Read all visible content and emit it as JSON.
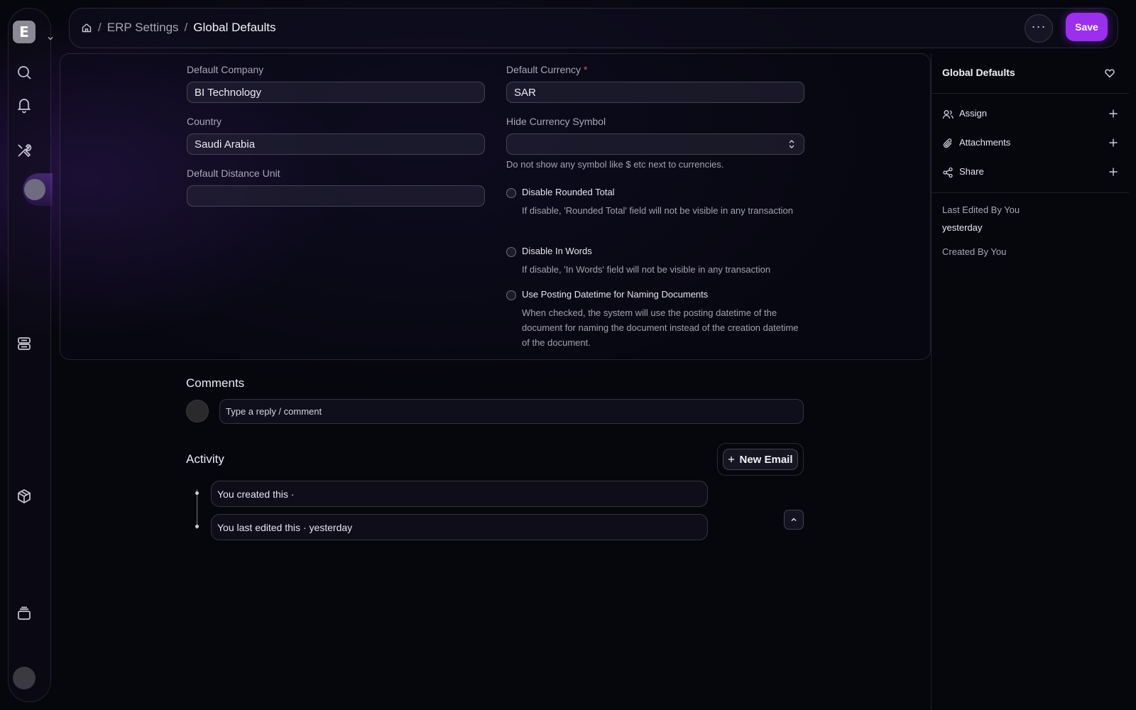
{
  "app": {
    "logo_letter": "E"
  },
  "breadcrumb": {
    "items": [
      "ERP Settings"
    ],
    "current": "Global Defaults",
    "separator": "/"
  },
  "header": {
    "more_label": "···",
    "save_label": "Save"
  },
  "form": {
    "default_company": {
      "label": "Default Company",
      "value": "BI Technology"
    },
    "country": {
      "label": "Country",
      "value": "Saudi Arabia"
    },
    "default_distance_unit": {
      "label": "Default Distance Unit",
      "value": ""
    },
    "default_currency": {
      "label": "Default Currency",
      "required_mark": "*",
      "value": "SAR"
    },
    "hide_currency_symbol": {
      "label": "Hide Currency Symbol",
      "value": "",
      "hint": "Do not show any symbol like $ etc next to currencies."
    },
    "checkboxes": [
      {
        "title": "Disable Rounded Total",
        "description": "If disable, 'Rounded Total' field will not be visible in any transaction",
        "checked": false
      },
      {
        "title": "Disable In Words",
        "description": "If disable, 'In Words' field will not be visible in any transaction",
        "checked": false
      },
      {
        "title": "Use Posting Datetime for Naming Documents",
        "description": "When checked, the system will use the posting datetime of the document for naming the document instead of the creation datetime of the document.",
        "checked": false
      }
    ]
  },
  "comments": {
    "title": "Comments",
    "placeholder": "Type a reply / comment"
  },
  "activity": {
    "title": "Activity",
    "new_email_label": "New Email",
    "items": [
      "You created this ·",
      "You last edited this · yesterday"
    ]
  },
  "sidebar": {
    "title": "Global Defaults",
    "actions": [
      {
        "label": "Assign",
        "icon": "user-icon"
      },
      {
        "label": "Attachments",
        "icon": "paperclip-icon"
      },
      {
        "label": "Share",
        "icon": "share-icon"
      }
    ],
    "last_edited_label": "Last Edited By You",
    "last_edited_value": "yesterday",
    "created_label": "Created By You"
  },
  "colors": {
    "accent": "#9b2ff0",
    "required": "#e0575b",
    "background": "#06060d"
  }
}
